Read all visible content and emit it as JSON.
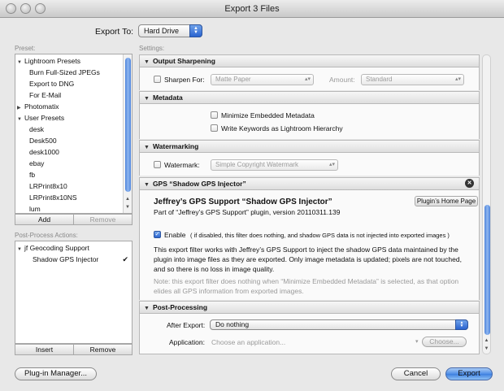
{
  "window": {
    "title": "Export 3 Files"
  },
  "export_to": {
    "label": "Export To:",
    "value": "Hard Drive"
  },
  "preset": {
    "label": "Preset:",
    "groups": [
      {
        "name": "Lightroom Presets",
        "expanded": true
      },
      {
        "name": "Photomatix",
        "expanded": false
      },
      {
        "name": "User Presets",
        "expanded": true
      }
    ],
    "items": {
      "lightroom": [
        "Burn Full-Sized JPEGs",
        "Export to DNG",
        "For E-Mail"
      ],
      "user": [
        "desk",
        "Desk500",
        "desk1000",
        "ebay",
        "fb",
        "LRPrint8x10",
        "LRPrint8x10NS",
        "lum"
      ]
    },
    "add_label": "Add",
    "remove_label": "Remove"
  },
  "post_process_actions": {
    "label": "Post-Process Actions:",
    "group": "jf Geocoding Support",
    "item": "Shadow GPS Injector",
    "checkmark": "✔",
    "insert_label": "Insert",
    "remove_label": "Remove"
  },
  "settings": {
    "label": "Settings:",
    "output_sharpening": {
      "title": "Output Sharpening",
      "sharpen_label": "Sharpen For:",
      "sharpen_value": "Matte Paper",
      "amount_label": "Amount:",
      "amount_value": "Standard"
    },
    "metadata": {
      "title": "Metadata",
      "minimize_label": "Minimize Embedded Metadata",
      "keywords_label": "Write Keywords as Lightroom Hierarchy"
    },
    "watermarking": {
      "title": "Watermarking",
      "watermark_label": "Watermark:",
      "watermark_value": "Simple Copyright Watermark"
    },
    "gps": {
      "title": "GPS “Shadow GPS Injector”",
      "heading": "Jeffrey’s GPS Support “Shadow GPS Injector”",
      "subheading": "Part of “Jeffrey’s GPS Support” plugin, version 20110311.139",
      "home_button": "Plugin’s Home Page",
      "enable_label": "Enable",
      "enable_note": "( if disabled, this filter does nothing, and shadow GPS data is not injected into exported images )",
      "description": [
        "This export filter works with Jeffrey’s GPS Support to inject the shadow GPS data maintained by the",
        "plugin into image files as they are exported. Only image metadata is updated; pixels are not touched,",
        "and so there is no loss in image quality."
      ],
      "note": [
        "Note: this export filter does nothing when “Minimize Embedded Metadata” is selected, as that option",
        "elides all GPS information from exported images."
      ],
      "close_glyph": "✕"
    },
    "post_processing": {
      "title": "Post-Processing",
      "after_export_label": "After Export:",
      "after_export_value": "Do nothing",
      "application_label": "Application:",
      "application_placeholder": "Choose an application...",
      "choose_label": "Choose..."
    }
  },
  "footer": {
    "plugin_manager": "Plug-in Manager...",
    "cancel": "Cancel",
    "export": "Export"
  },
  "icons": {
    "expanded": "▼",
    "collapsed": "▶",
    "popup_arrows": "▴▾",
    "dropdown": "▾",
    "scroll_up": "▲",
    "scroll_down": "▼"
  }
}
